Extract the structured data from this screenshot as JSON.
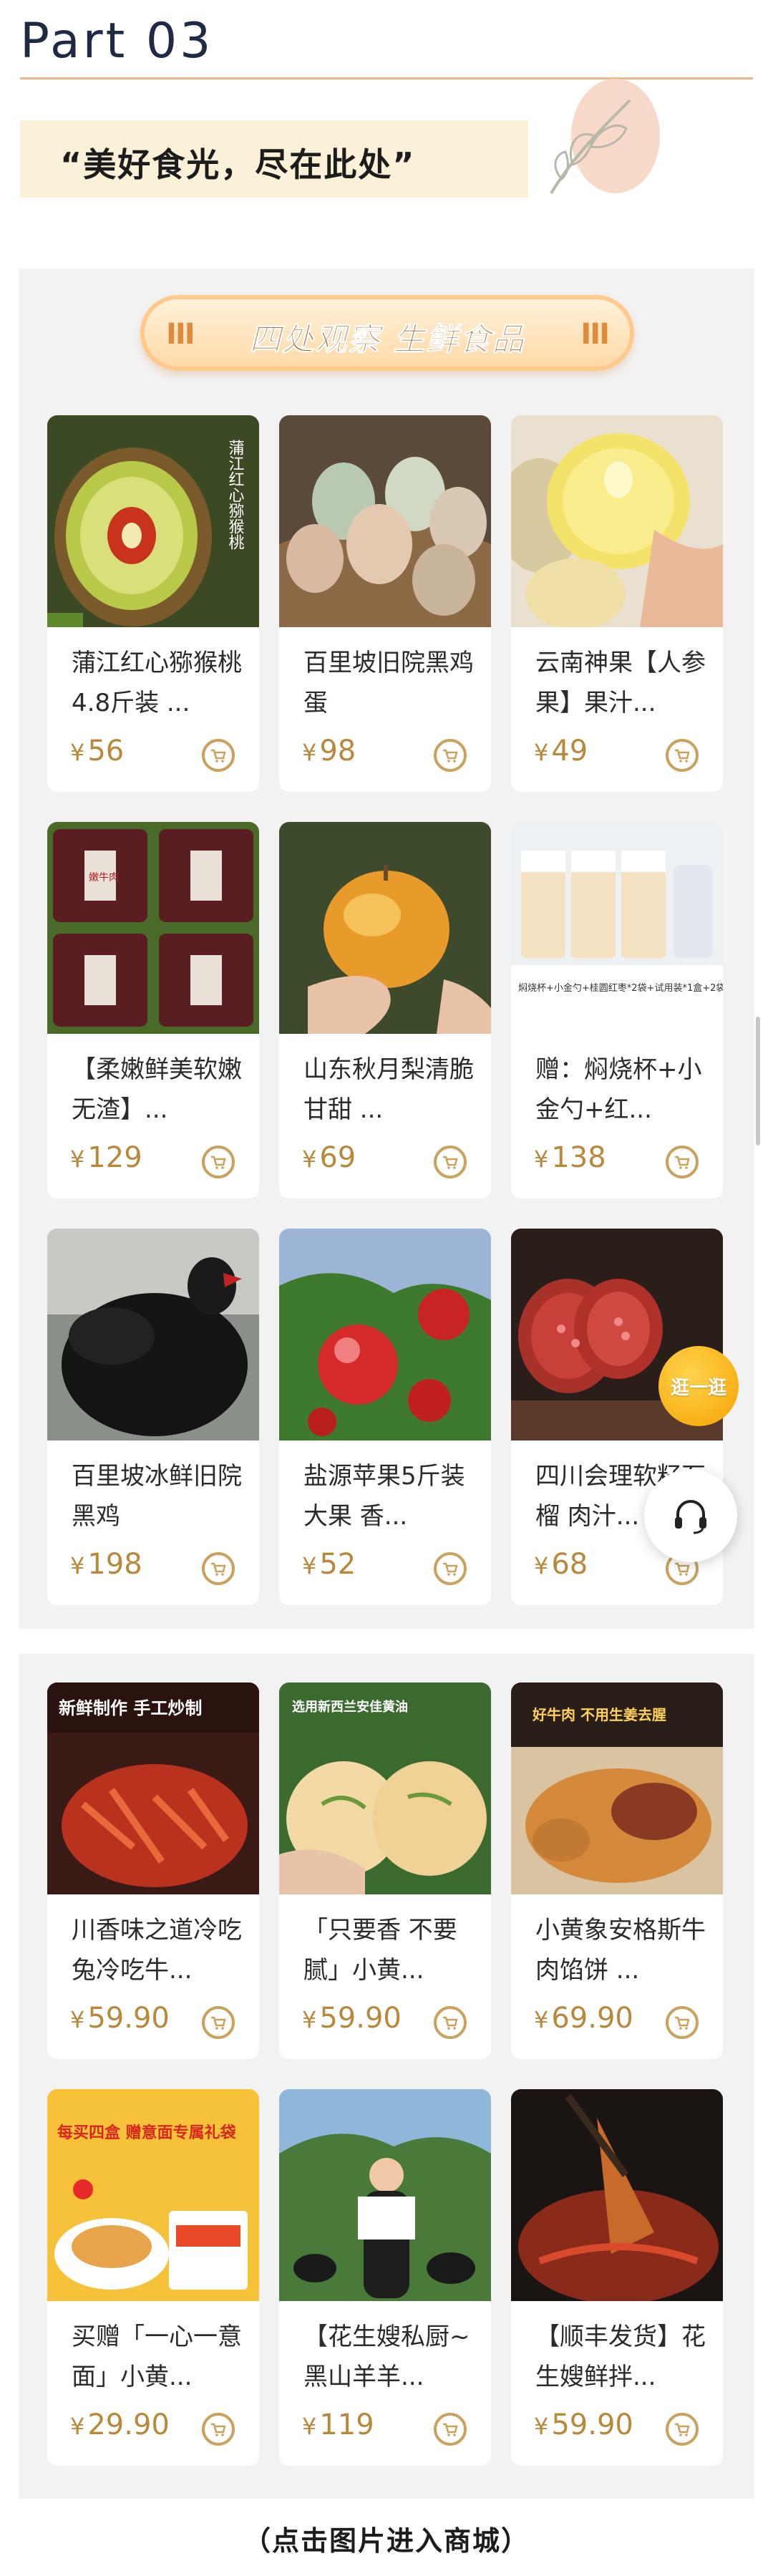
{
  "section": {
    "part_label": "Part 03",
    "slogan": "“美好食光，尽在此处”",
    "banner_title": "四处观察 生鲜食品",
    "footer_hint": "（点击图片进入商城）"
  },
  "floating": {
    "shop_badge": "逛一逛",
    "customer_service_icon": "headset-icon"
  },
  "products": [
    {
      "name": "蒲江红心猕猴桃4.8斤装 ...",
      "price": "56",
      "image": "red-kiwi",
      "image_text": "蒲江红心猕猴桃"
    },
    {
      "name": "百里坡旧院黑鸡蛋",
      "price": "98",
      "image": "eggs-basket"
    },
    {
      "name": "云南神果【人参果】果汁...",
      "price": "49",
      "image": "pepino-fruit"
    },
    {
      "name": "【柔嫩鲜美软嫩无渣】...",
      "price": "129",
      "image": "meat-boxes",
      "image_text": "嫩牛肉"
    },
    {
      "name": "山东秋月梨清脆甘甜 ...",
      "price": "69",
      "image": "golden-pear"
    },
    {
      "name": "赠：焖烧杯+小金勺+红...",
      "price": "138",
      "image": "jar-gift",
      "image_text": "焖烧杯+小金勺+桂圆红枣*2袋+试用装*1盒+2袋老冰糖"
    },
    {
      "name": "百里坡冰鲜旧院黑鸡",
      "price": "198",
      "image": "black-chicken"
    },
    {
      "name": "盐源苹果5斤装大果 香...",
      "price": "52",
      "image": "apples-tree"
    },
    {
      "name": "四川会理软籽石榴 肉汁...",
      "price": "68",
      "image": "pomegranate"
    }
  ],
  "products_2": [
    {
      "name": "川香味之道冷吃兔冷吃牛...",
      "price": "59.90",
      "image": "spicy-rabbit",
      "image_text": "新鲜制作 手工炒制"
    },
    {
      "name": "「只要香 不要腻」小黄...",
      "price": "59.90",
      "image": "scallion-pancake",
      "image_text": "选用新西兰安佳黄油"
    },
    {
      "name": "小黄象安格斯牛肉馅饼 ...",
      "price": "69.90",
      "image": "beef-pie",
      "image_text": "好牛肉 不用生姜去腥"
    },
    {
      "name": "买赠「一心一意面」小黄...",
      "price": "29.90",
      "image": "pasta-box",
      "image_text": "每买四盒 赠意面专属礼袋"
    },
    {
      "name": "【花生嫂私厨~黑山羊羊...",
      "price": "119",
      "image": "woman-goats"
    },
    {
      "name": "【顺丰发货】花生嫂鲜拌...",
      "price": "59.90",
      "image": "spicy-dish"
    }
  ],
  "colors": {
    "accent_gold": "#b8893d",
    "panel_bg": "#f2f2f2",
    "title_navy": "#1f2a44",
    "banner_orange": "#ffd9a8"
  }
}
